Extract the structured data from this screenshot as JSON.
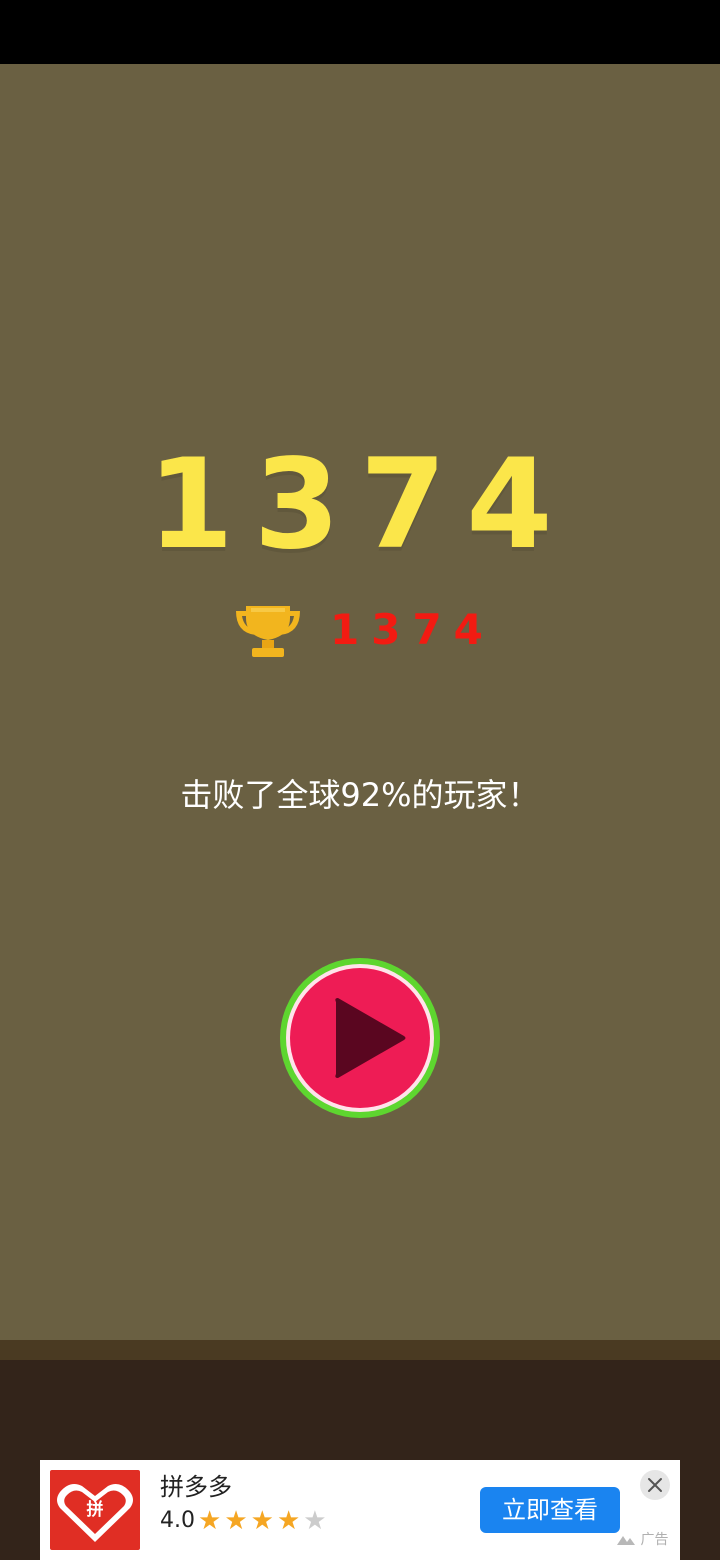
{
  "game": {
    "score": "1374",
    "best_score": "1374",
    "rank_message": "击败了全球92%的玩家！",
    "icons": {
      "trophy": "trophy-icon",
      "play": "play-icon"
    },
    "colors": {
      "background": "#6a6042",
      "score": "#fbe64a",
      "best_score": "#f21b12",
      "play_ring": "#5ed62f",
      "play_fill": "#ee1c55",
      "play_triangle": "#5a0620",
      "ground": "#33241a"
    }
  },
  "ad": {
    "app_name": "拼多多",
    "logo_text": "拼",
    "rating": "4.0",
    "stars_total": 5,
    "stars_filled": 4,
    "cta_label": "立即查看",
    "label": "广告",
    "icons": {
      "close": "close-icon",
      "star": "star-icon",
      "ad-mark": "ad-mark-icon"
    },
    "colors": {
      "cta": "#1a84f0",
      "logo": "#e02e24",
      "star": "#f5a623"
    }
  }
}
